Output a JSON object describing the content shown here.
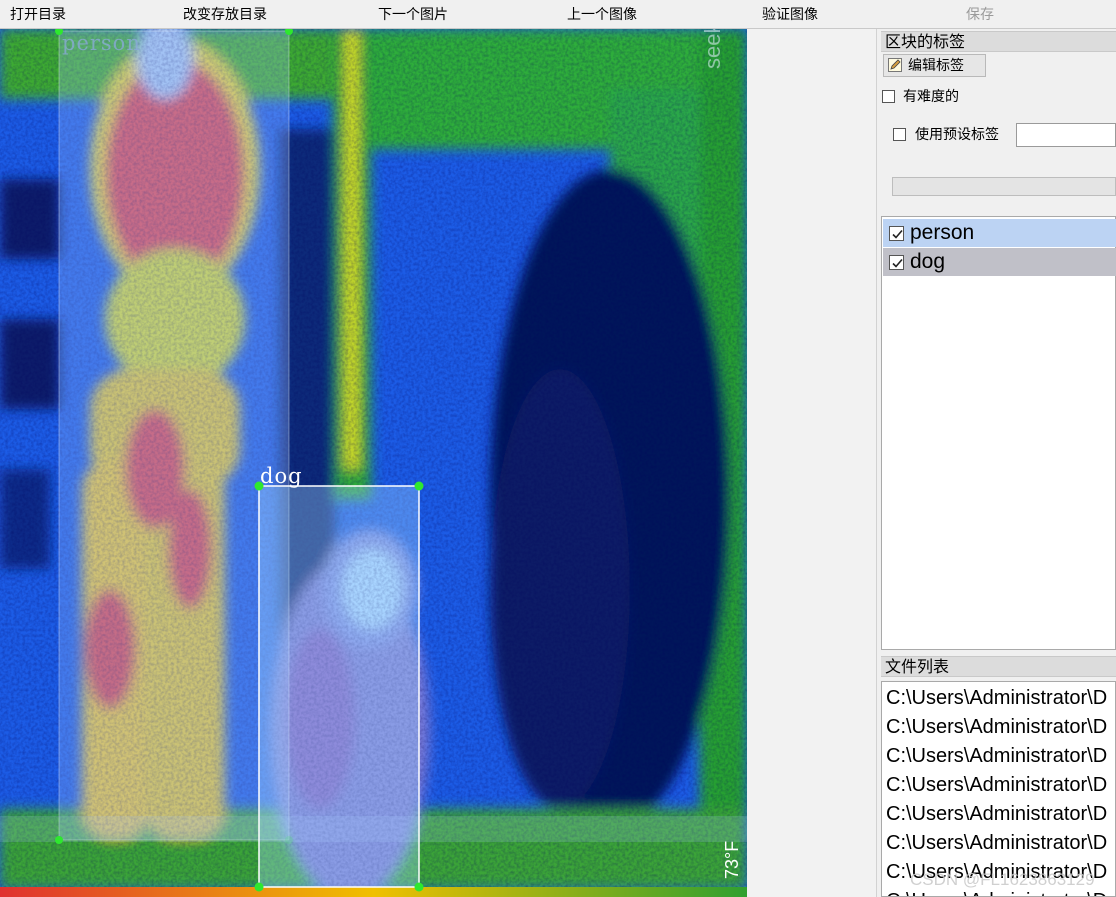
{
  "toolbar": {
    "open_dir": "打开目录",
    "change_save_dir": "改变存放目录",
    "next_image": "下一个图片",
    "prev_image": "上一个图像",
    "verify_image": "验证图像",
    "save": "保存"
  },
  "canvas": {
    "boxes": [
      {
        "label": "person",
        "color": "#2ee82e"
      },
      {
        "label": "dog",
        "color": "#2ee82e"
      }
    ],
    "overlay_texts": {
      "brand": "seek",
      "temperature": "73°F"
    }
  },
  "dock": {
    "block_labels_title": "区块的标签",
    "edit_label_button": "编辑标签",
    "difficult_label": "有难度的",
    "use_preset_label": "使用预设标签",
    "preset_value": "",
    "label_list": [
      {
        "name": "person",
        "checked": true,
        "selected": true
      },
      {
        "name": "dog",
        "checked": true,
        "selected": false
      }
    ],
    "file_list_title": "文件列表",
    "file_list": [
      "C:\\Users\\Administrator\\D",
      "C:\\Users\\Administrator\\D",
      "C:\\Users\\Administrator\\D",
      "C:\\Users\\Administrator\\D",
      "C:\\Users\\Administrator\\D",
      "C:\\Users\\Administrator\\D",
      "C:\\Users\\Administrator\\D",
      "C:\\Users\\Administrator\\D"
    ]
  },
  "watermark": "CSDN @FL1623863129",
  "colors": {
    "selected_row": "#bcd3f3",
    "unselected_row": "#c0c0c8",
    "handle": "#2ee82e"
  }
}
